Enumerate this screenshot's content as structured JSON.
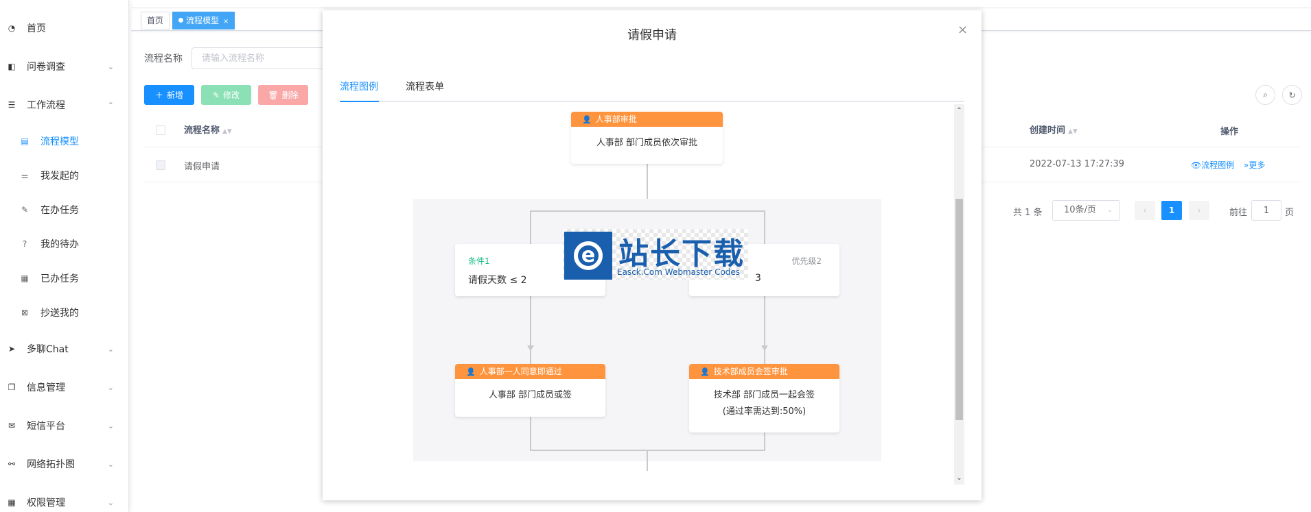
{
  "sidebar": {
    "items": [
      {
        "label": "首页",
        "icon": "dashboard-icon"
      },
      {
        "label": "问卷调查",
        "icon": "book-icon",
        "arrow": "⌄"
      },
      {
        "label": "工作流程",
        "icon": "list-icon",
        "arrow": "⌃"
      },
      {
        "label": "多聊Chat",
        "icon": "send-icon",
        "arrow": "⌄"
      },
      {
        "label": "信息管理",
        "icon": "copy-icon",
        "arrow": "⌄"
      },
      {
        "label": "短信平台",
        "icon": "mail-icon",
        "arrow": "⌄"
      },
      {
        "label": "网络拓扑图",
        "icon": "tree-icon",
        "arrow": "⌄"
      },
      {
        "label": "权限管理",
        "icon": "grid-icon",
        "arrow": "⌄"
      }
    ],
    "sub_items": [
      {
        "label": "流程模型",
        "icon": "doc-edit-icon"
      },
      {
        "label": "我发起的",
        "icon": "sliders-icon"
      },
      {
        "label": "在办任务",
        "icon": "edit-icon"
      },
      {
        "label": "我的待办",
        "icon": "question-icon"
      },
      {
        "label": "已办任务",
        "icon": "table-icon"
      },
      {
        "label": "抄送我的",
        "icon": "image-icon"
      }
    ]
  },
  "tags": {
    "home": "首页",
    "active": "流程模型",
    "close": "×"
  },
  "search": {
    "label": "流程名称",
    "placeholder": "请输入流程名称"
  },
  "toolbar": {
    "add": "新增",
    "edit": "修改",
    "delete": "删除"
  },
  "table": {
    "columns": {
      "name": "流程名称",
      "created": "创建时间",
      "ops": "操作"
    },
    "rows": [
      {
        "name": "请假申请",
        "created": "2022-07-13 17:27:39",
        "op_view": "流程图例",
        "op_more": "更多"
      }
    ]
  },
  "pagination": {
    "total": "共 1 条",
    "page_size": "10条/页",
    "current": "1",
    "goto_label": "前往",
    "goto_value": "1",
    "page_suffix": "页"
  },
  "dialog": {
    "title": "请假申请",
    "close": "×",
    "tabs": [
      "流程图例",
      "流程表单"
    ],
    "nodes": {
      "top": {
        "head": "人事部审批",
        "body": "人事部 部门成员依次审批"
      },
      "left": {
        "head": "人事部一人同意即通过",
        "body": "人事部 部门成员或签"
      },
      "right": {
        "head": "技术部成员会签审批",
        "body_line1": "技术部 部门成员一起会签",
        "body_line2": "(通过率需达到:50%)"
      }
    },
    "conditions": {
      "left": {
        "title": "条件1",
        "prio": "优",
        "text": "请假天数 ≤ 2"
      },
      "right": {
        "prio": "优先级2",
        "text": "3"
      }
    }
  },
  "watermark": {
    "cn": "站长下载",
    "en": "Easck.Com Webmaster Codes"
  },
  "colors": {
    "primary": "#1890ff",
    "node_head": "#ff943e",
    "condition_title": "#15bc83"
  }
}
